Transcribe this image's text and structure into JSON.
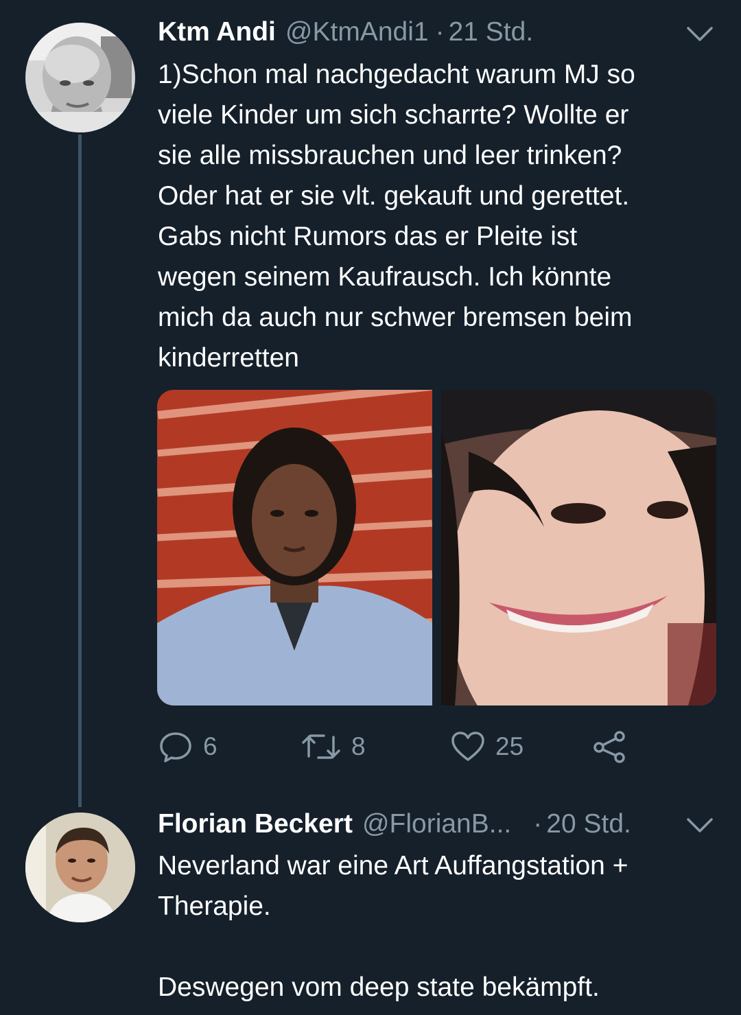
{
  "colors": {
    "background": "#15202b",
    "secondary_text": "#8899a6",
    "thread_line": "#3d5466"
  },
  "tweets": [
    {
      "author_name": "Ktm Andi",
      "handle": "@KtmAndi1",
      "separator": "·",
      "time": "21 Std.",
      "text": "1)Schon mal nachgedacht warum MJ so\nviele Kinder um sich scharrte? Wollte er\nsie alle missbrauchen und leer trinken?\nOder hat er sie vlt. gekauft und gerettet.\nGabs nicht Rumors das er Pleite ist\nwegen seinem Kaufrausch. Ich könnte\nmich da auch nur schwer bremsen beim\nkinderretten",
      "menu_icon": "chevron-down-icon",
      "actions": {
        "reply": {
          "icon": "reply-icon",
          "count": "6"
        },
        "retweet": {
          "icon": "retweet-icon",
          "count": "8"
        },
        "like": {
          "icon": "heart-icon",
          "count": "25"
        },
        "share": {
          "icon": "share-icon"
        }
      }
    },
    {
      "author_name": "Florian Beckert",
      "handle": "@FlorianB...",
      "separator": "·",
      "time": "20 Std.",
      "text": "Neverland war eine Art Auffangstation +\nTherapie.\n\nDeswegen vom deep state bekämpft.",
      "menu_icon": "chevron-down-icon"
    }
  ]
}
